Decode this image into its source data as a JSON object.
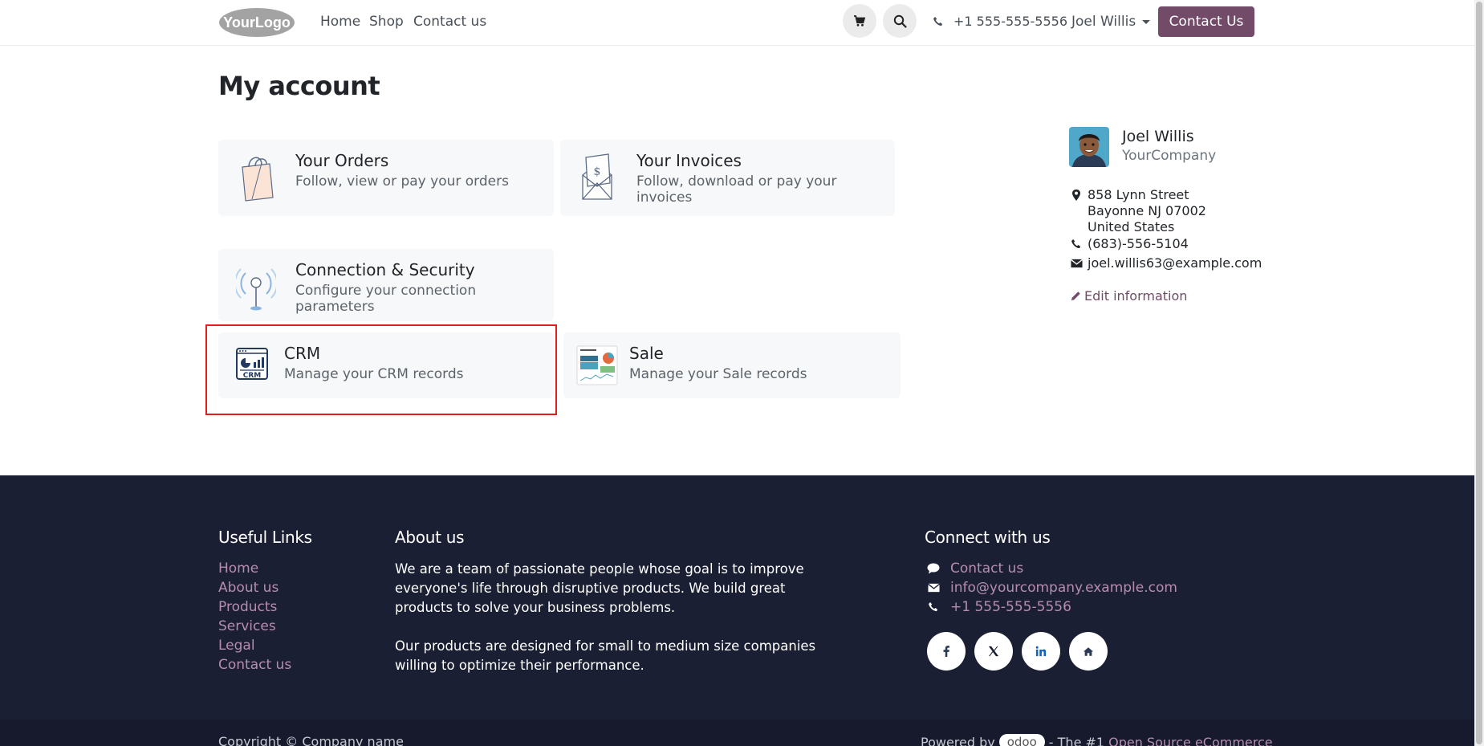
{
  "header": {
    "logo_text": "YourLogo",
    "nav": [
      "Home",
      "Shop",
      "Contact us"
    ],
    "phone": "+1 555-555-5556",
    "user": "Joel Willis",
    "cta": "Contact Us"
  },
  "main": {
    "title": "My account",
    "cards": [
      {
        "title": "Your Orders",
        "desc": "Follow, view or pay your orders"
      },
      {
        "title": "Your Invoices",
        "desc": "Follow, download or pay your invoices"
      },
      {
        "title": "Connection & Security",
        "desc": "Configure your connection parameters"
      },
      {
        "title": "CRM",
        "desc": "Manage your CRM records"
      },
      {
        "title": "Sale",
        "desc": "Manage your Sale records"
      }
    ],
    "crm_icon_text": "CRM"
  },
  "sidebar": {
    "name": "Joel Willis",
    "company": "YourCompany",
    "address": [
      "858 Lynn Street",
      "Bayonne NJ 07002",
      "United States"
    ],
    "phone": "(683)-556-5104",
    "email": "joel.willis63@example.com",
    "edit": "Edit information"
  },
  "footer": {
    "useful_links_title": "Useful Links",
    "useful_links": [
      "Home",
      "About us",
      "Products",
      "Services",
      "Legal",
      "Contact us"
    ],
    "about_title": "About us",
    "about_p1": "We are a team of passionate people whose goal is to improve everyone's life through disruptive products. We build great products to solve your business problems.",
    "about_p2": "Our products are designed for small to medium size companies willing to optimize their performance.",
    "connect_title": "Connect with us",
    "connect": [
      "Contact us",
      "info@yourcompany.example.com",
      "+1 555-555-5556"
    ],
    "copyright": "Copyright © Company name",
    "powered_prefix": "Powered by",
    "powered_brand": "odoo",
    "powered_mid": "- The #1",
    "powered_link": "Open Source eCommerce"
  },
  "colors": {
    "brand": "#714b67",
    "footer_bg": "#1a1f33",
    "footer_link": "#b68db0",
    "highlight": "#e11d1d"
  }
}
